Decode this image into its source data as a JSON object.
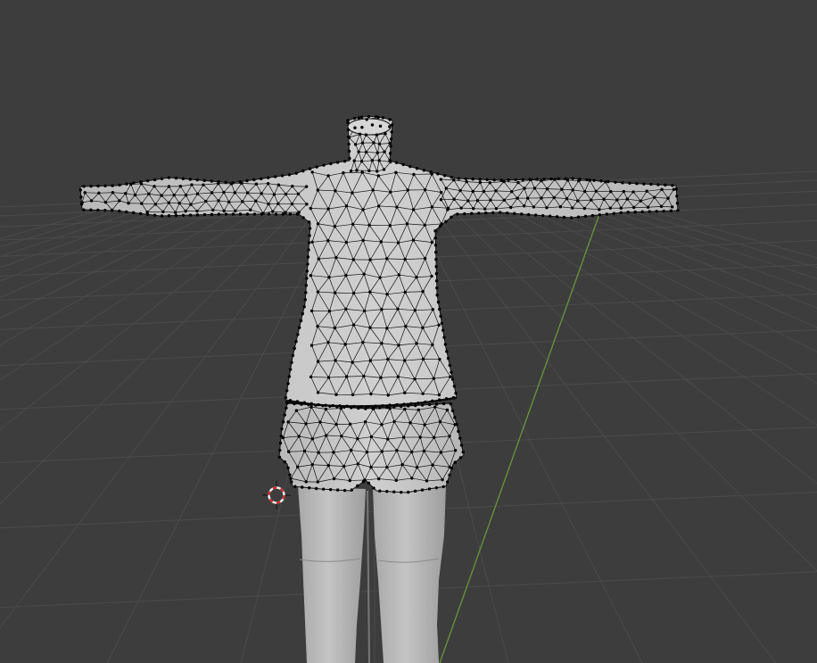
{
  "viewport": {
    "background": "#3d3d3d",
    "grid_color": "#4a4a4a",
    "grid_dark_color": "#353535",
    "y_axis_color": "#6b8e3a"
  },
  "scene": {
    "mesh_fill": "#c9c9c9",
    "mesh_shade": "#b4b4b4",
    "wire_color": "#111111",
    "vertex_color": "#000000",
    "legs_fill": "#bdbdbd",
    "legs_shade": "#a6a6a6",
    "cursor_colors": {
      "ring_red": "#cc2a2a",
      "ring_white": "#f0f0f0",
      "crosshair": "#1a1a1a"
    }
  }
}
